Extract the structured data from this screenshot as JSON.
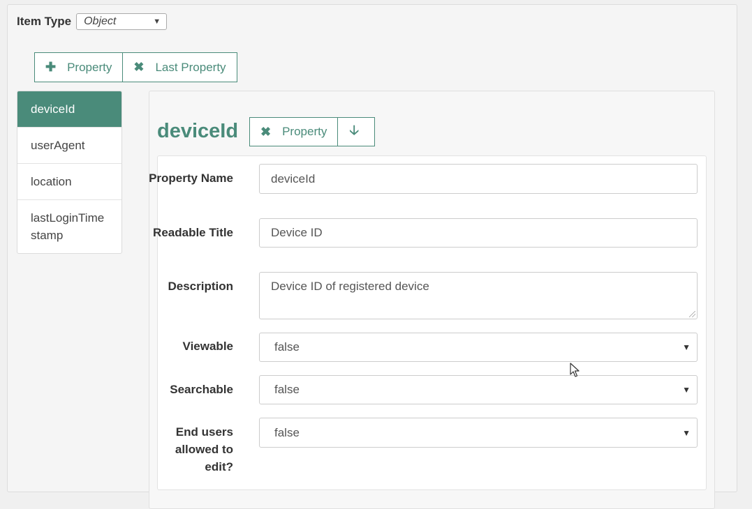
{
  "item_type": {
    "label": "Item Type",
    "selected": "Object"
  },
  "toolbar": {
    "add_property": "Property",
    "remove_last": "Last Property"
  },
  "properties": [
    {
      "name": "deviceId",
      "active": true
    },
    {
      "name": "userAgent"
    },
    {
      "name": "location"
    },
    {
      "name": "lastLoginTime stamp"
    }
  ],
  "detail": {
    "title": "deviceId",
    "remove_property": "Property",
    "fields": {
      "property_name": {
        "label": "Property Name",
        "value": "deviceId"
      },
      "readable_title": {
        "label": "Readable Title",
        "value": "Device ID"
      },
      "description": {
        "label": "Description",
        "value": "Device ID of registered device"
      },
      "viewable": {
        "label": "Viewable",
        "value": "false"
      },
      "searchable": {
        "label": "Searchable",
        "value": "false"
      },
      "end_users_edit": {
        "label": "End users allowed to edit?",
        "value": "false"
      }
    }
  },
  "icons": {
    "add": "plus-icon",
    "remove": "times-icon",
    "move_down": "arrow-down-icon"
  },
  "colors": {
    "accent": "#4a8b7a"
  }
}
